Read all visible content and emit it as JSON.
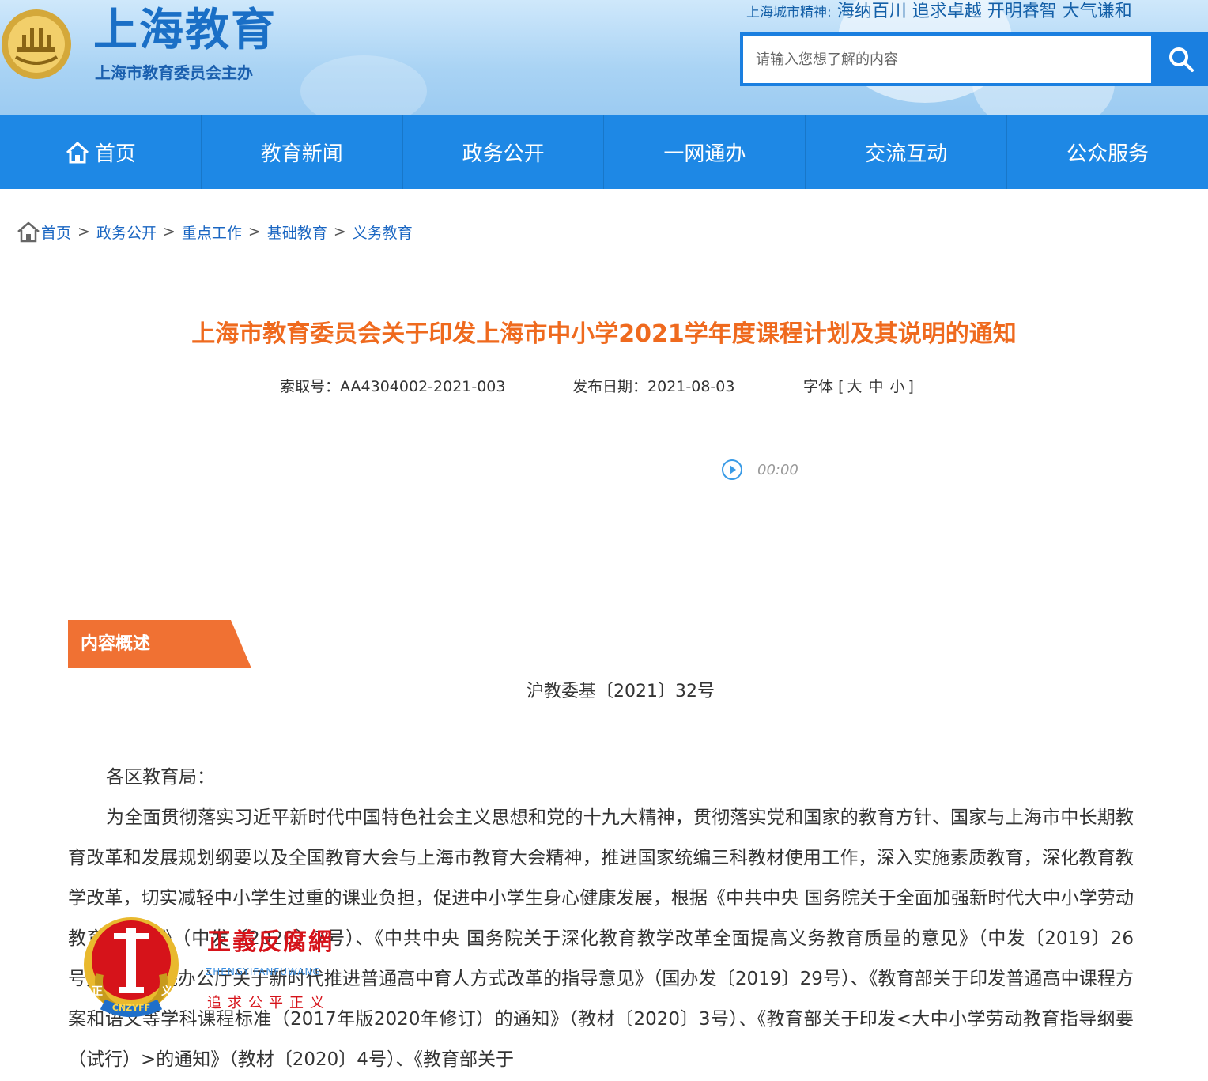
{
  "header": {
    "site_title": "上海教育",
    "site_subtitle": "上海市教育委员会主办",
    "slogan_label": "上海城市精神:",
    "slogan_text": "海纳百川 追求卓越 开明睿智 大气谦和",
    "search_placeholder": "请输入您想了解的内容"
  },
  "nav": [
    {
      "label": "首页"
    },
    {
      "label": "教育新闻"
    },
    {
      "label": "政务公开"
    },
    {
      "label": "一网通办"
    },
    {
      "label": "交流互动"
    },
    {
      "label": "公众服务"
    }
  ],
  "breadcrumb": [
    {
      "label": "首页"
    },
    {
      "label": "政务公开"
    },
    {
      "label": "重点工作"
    },
    {
      "label": "基础教育"
    },
    {
      "label": "义务教育"
    }
  ],
  "breadcrumb_sep": ">",
  "article": {
    "title": "上海市教育委员会关于印发上海市中小学2021学年度课程计划及其说明的通知",
    "index_label": "索取号：",
    "index_value": "AA4304002-2021-003",
    "date_label": "发布日期：",
    "date_value": "2021-08-03",
    "font_label": "字体",
    "font_open": "[",
    "font_close": "]",
    "font_large": "大",
    "font_medium": "中",
    "font_small": "小",
    "audio_time": "00:00",
    "summary_label": "内容概述",
    "doc_number": "沪教委基〔2021〕32号",
    "salutation": "各区教育局：",
    "paragraph": "为全面贯彻落实习近平新时代中国特色社会主义思想和党的十九大精神，贯彻落实党和国家的教育方针、国家与上海市中长期教育改革和发展规划纲要以及全国教育大会与上海市教育大会精神，推进国家统编三科教材使用工作，深入实施素质教育，深化教育教学改革，切实减轻中小学生过重的课业负担，促进中小学生身心健康发展，根据《中共中央 国务院关于全面加强新时代大中小学劳动教育的意见》（中发〔2020〕7号）、《中共中央 国务院关于深化教育教学改革全面提高义务教育质量的意见》（中发〔2019〕26号）、《国务院办公厅关于新时代推进普通高中育人方式改革的指导意见》（国办发〔2019〕29号）、《教育部关于印发普通高中课程方案和语文等学科课程标准（2017年版2020年修订）的通知》（教材〔2020〕3号）、《教育部关于印发<大中小学劳动教育指导纲要（试行）>的通知》（教材〔2020〕4号）、《教育部关于"
  },
  "watermark": {
    "name": "正義反腐網",
    "pinyin": "ZHENGYIFANFUWANG",
    "motto": "追求公平正义",
    "badge_text": "CNZYFF",
    "badge_chars_left": "正",
    "badge_chars_right": "义"
  },
  "colors": {
    "nav_blue": "#1e88e5",
    "title_orange": "#ef6a1e",
    "summary_orange": "#f07133",
    "link_blue": "#1a66c2"
  }
}
